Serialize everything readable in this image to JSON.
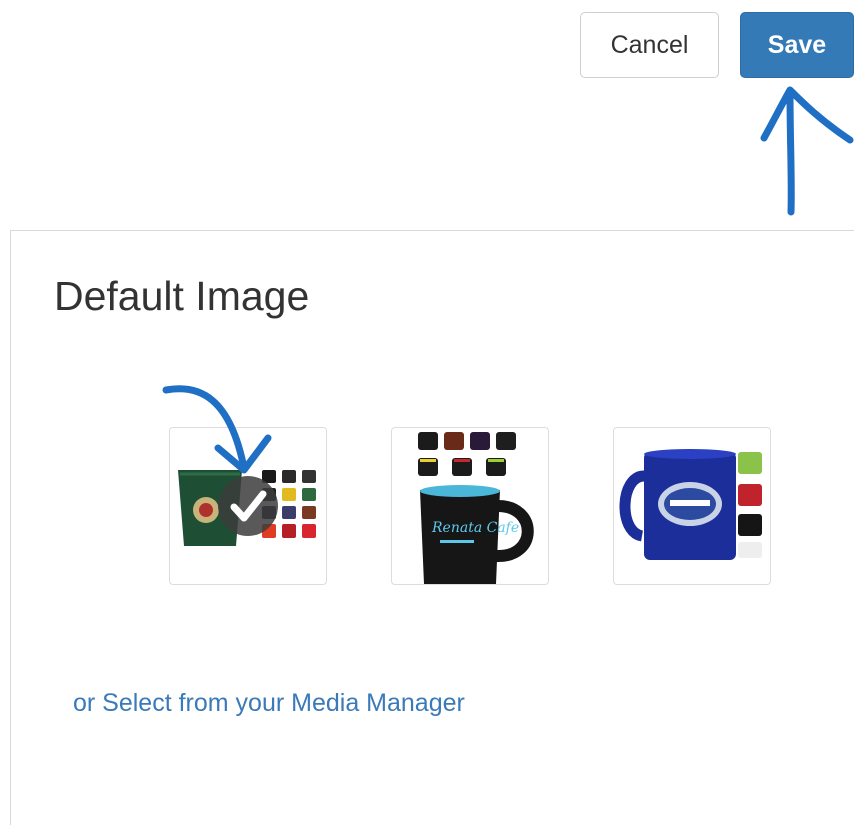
{
  "toolbar": {
    "cancel_label": "Cancel",
    "save_label": "Save"
  },
  "panel": {
    "title": "Default Image",
    "thumbnails": [
      {
        "name": "mixed-color-mugs",
        "selected": true,
        "selected_icon": "checkmark-icon"
      },
      {
        "name": "black-bistro-mugs",
        "selected": false
      },
      {
        "name": "blue-diner-mug",
        "selected": false
      }
    ],
    "media_link": "or Select from your Media Manager"
  },
  "colors": {
    "primary": "#337ab7",
    "link": "#3a7ab8",
    "annotation": "#1f6fc4",
    "border": "#dddddd"
  }
}
